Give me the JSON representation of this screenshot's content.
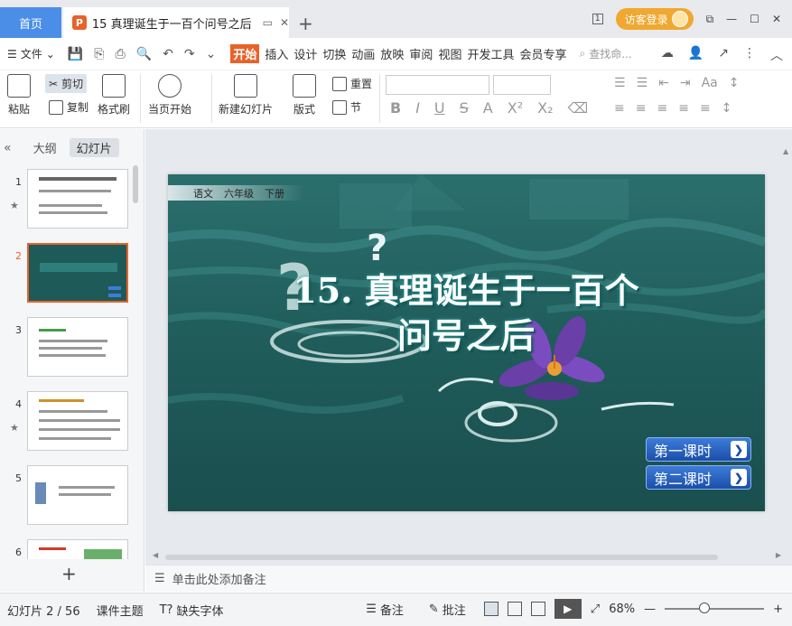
{
  "titlebar": {
    "home_tab": "首页",
    "doc_tab_icon": "P",
    "doc_tab_title": "15 真理诞生于一百个问号之后",
    "login": "访客登录",
    "page_indicator": "1"
  },
  "menubar": {
    "file": "文件",
    "items": [
      "开始",
      "插入",
      "设计",
      "切换",
      "动画",
      "放映",
      "审阅",
      "视图",
      "开发工具",
      "会员专享"
    ],
    "search_placeholder": "查找命..."
  },
  "ribbon": {
    "paste": "粘贴",
    "cut": "剪切",
    "copy": "复制",
    "format_painter": "格式刷",
    "from_current": "当页开始",
    "new_slide": "新建幻灯片",
    "layout": "版式",
    "reset": "重置",
    "section": "节"
  },
  "left_panel": {
    "tab_outline": "大纲",
    "tab_slides": "幻灯片",
    "thumbs": [
      {
        "num": "1",
        "star": true
      },
      {
        "num": "2",
        "star": false
      },
      {
        "num": "3",
        "star": false
      },
      {
        "num": "4",
        "star": true
      },
      {
        "num": "5",
        "star": false
      },
      {
        "num": "6",
        "star": false
      }
    ]
  },
  "slide": {
    "topbar": [
      "语文",
      "六年级",
      "下册"
    ],
    "title_line1": "15. 真理诞生于一百个",
    "title_line2": "问号之后",
    "btn1": "第一课时",
    "btn2": "第二课时"
  },
  "notes": {
    "placeholder": "单击此处添加备注"
  },
  "status": {
    "slide_counter": "幻灯片 2 / 56",
    "theme": "课件主题",
    "missing_font": "缺失字体",
    "notes": "备注",
    "comments": "批注",
    "zoom": "68%"
  }
}
